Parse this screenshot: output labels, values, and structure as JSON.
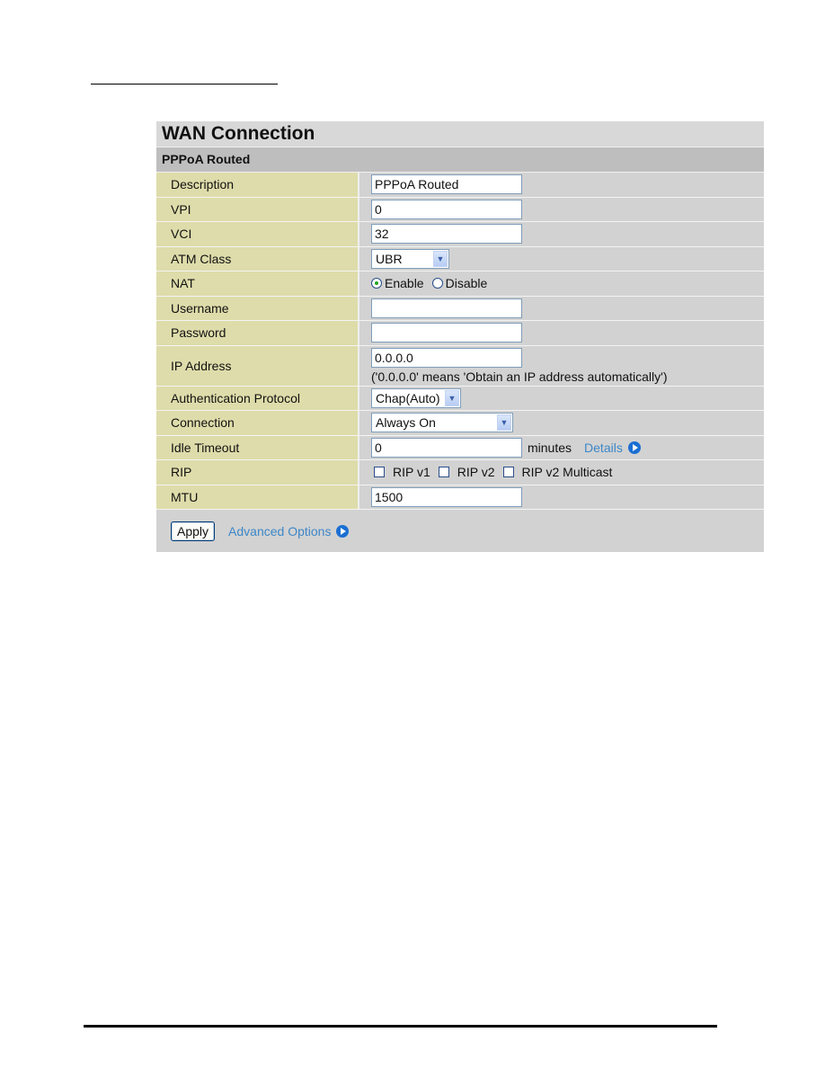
{
  "panel": {
    "title": "WAN Connection",
    "subtitle": "PPPoA Routed"
  },
  "fields": {
    "description": {
      "label": "Description",
      "value": "PPPoA Routed"
    },
    "vpi": {
      "label": "VPI",
      "value": "0"
    },
    "vci": {
      "label": "VCI",
      "value": "32"
    },
    "atm_class": {
      "label": "ATM Class",
      "selected": "UBR"
    },
    "nat": {
      "label": "NAT",
      "options": [
        "Enable",
        "Disable"
      ],
      "selected": "Enable"
    },
    "username": {
      "label": "Username",
      "value": ""
    },
    "password": {
      "label": "Password",
      "value": ""
    },
    "ip_address": {
      "label": "IP Address",
      "value": "0.0.0.0",
      "hint": "('0.0.0.0' means 'Obtain an IP address automatically')"
    },
    "auth_protocol": {
      "label": "Authentication Protocol",
      "selected": "Chap(Auto)"
    },
    "connection": {
      "label": "Connection",
      "selected": "Always On"
    },
    "idle_timeout": {
      "label": "Idle Timeout",
      "value": "0",
      "unit": "minutes",
      "details_link": "Details"
    },
    "rip": {
      "label": "RIP",
      "options": [
        {
          "label": "RIP v1",
          "checked": false
        },
        {
          "label": "RIP v2",
          "checked": false
        },
        {
          "label": "RIP v2 Multicast",
          "checked": false
        }
      ]
    },
    "mtu": {
      "label": "MTU",
      "value": "1500"
    }
  },
  "footer": {
    "apply_label": "Apply",
    "advanced_link": "Advanced Options"
  }
}
